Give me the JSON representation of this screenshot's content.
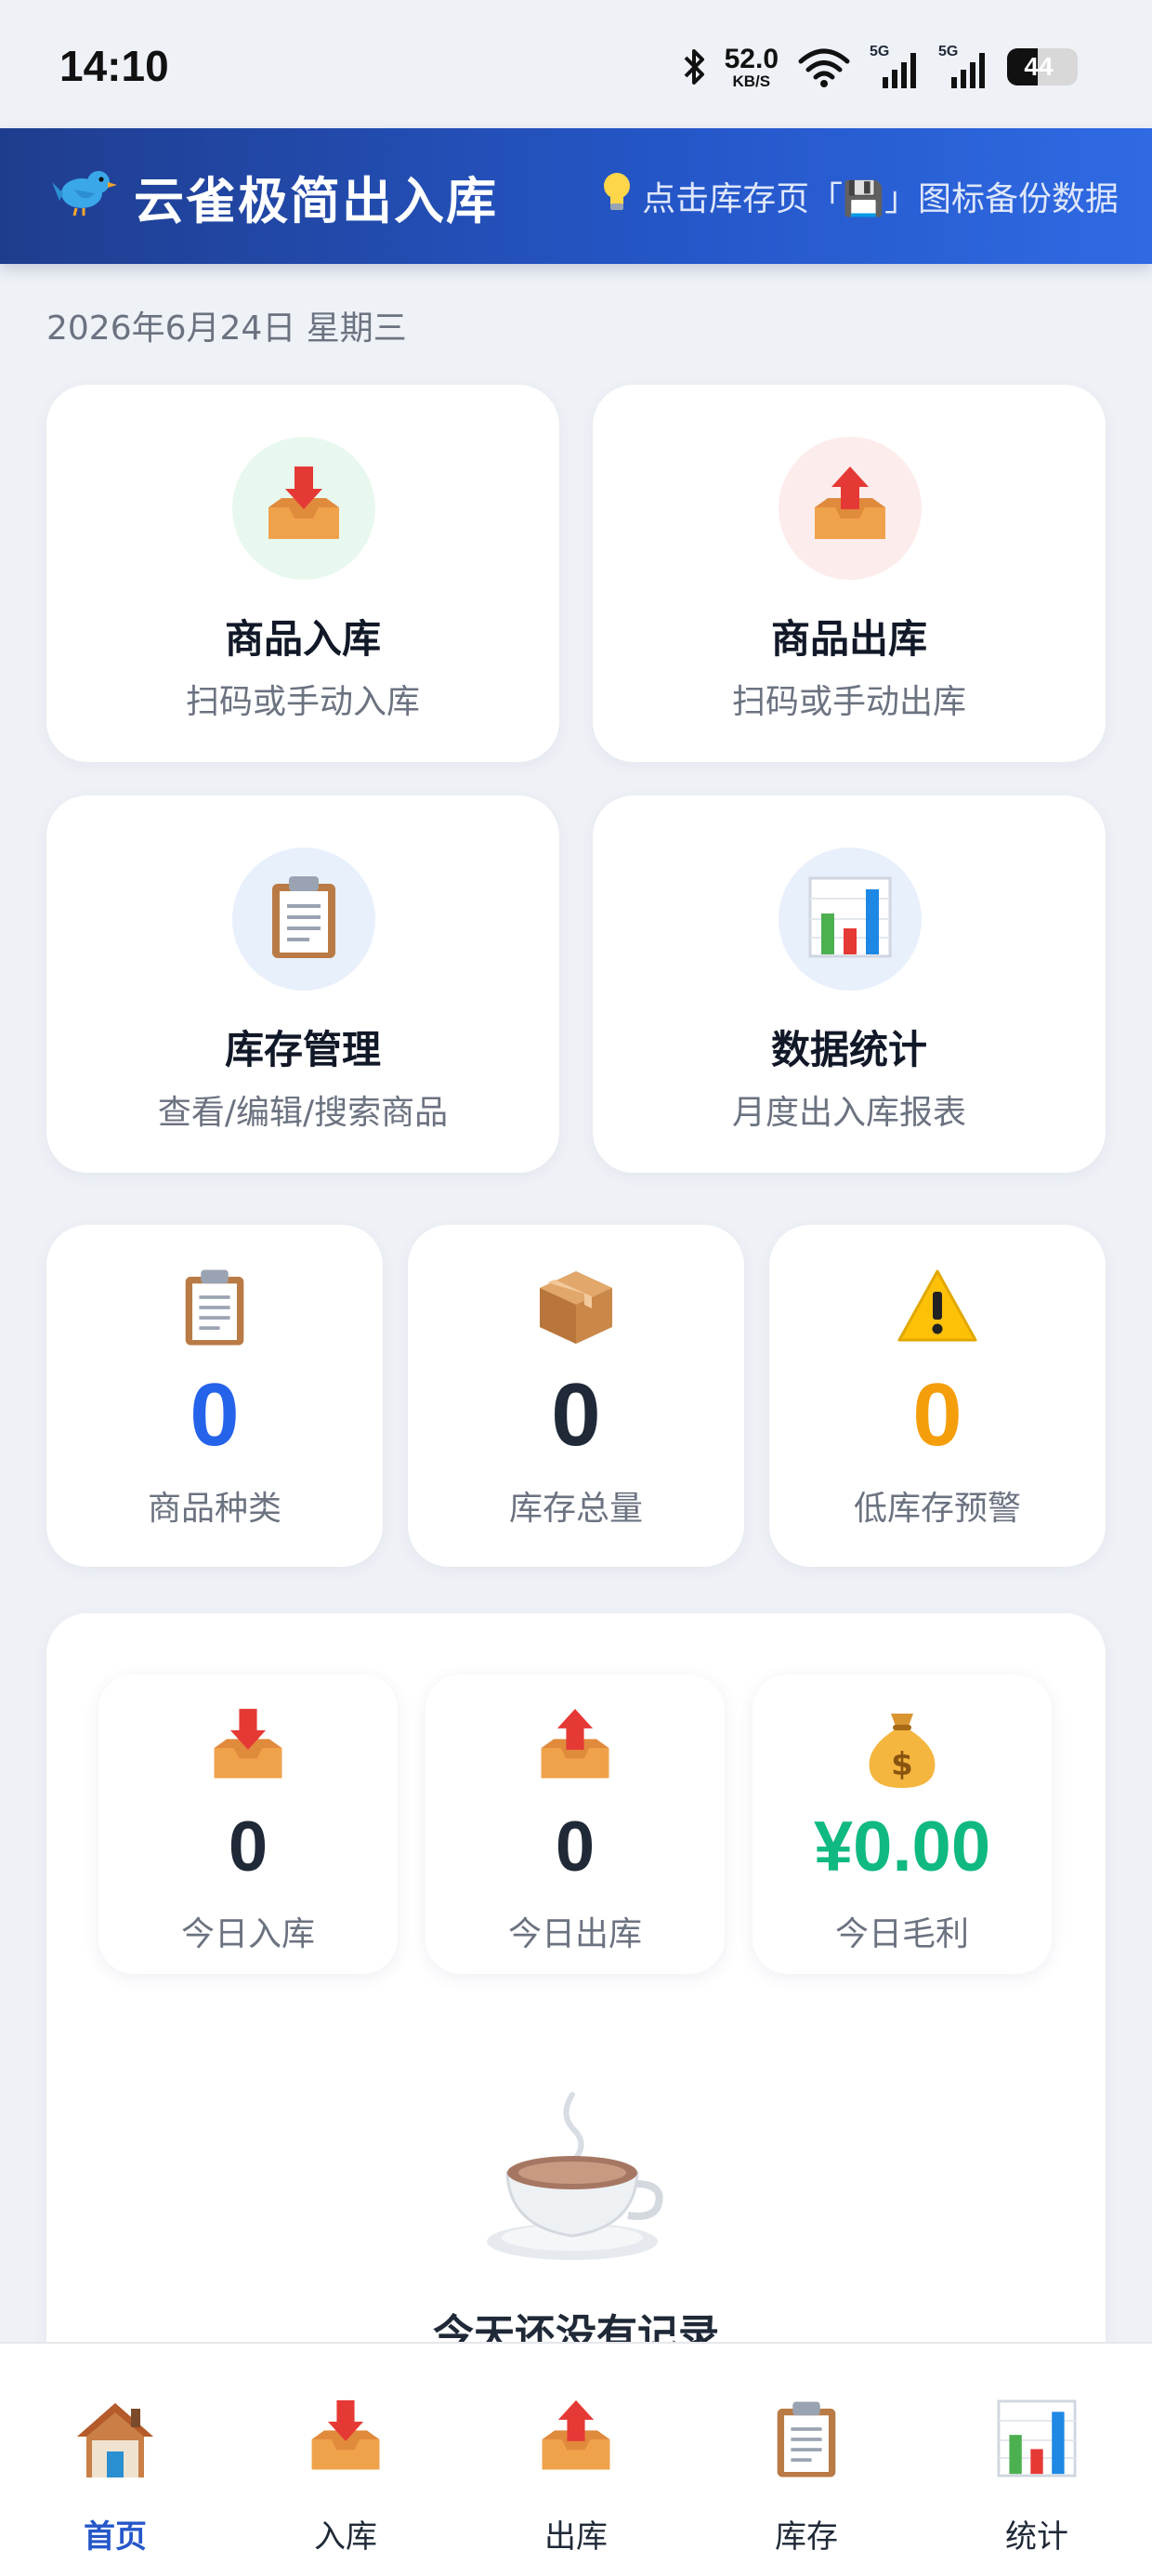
{
  "status_bar": {
    "time": "14:10",
    "net_speed_value": "52.0",
    "net_speed_unit": "KB/S",
    "signal_1_label": "5G",
    "signal_2_label": "5G",
    "battery_level": "44"
  },
  "header": {
    "title": "云雀极简出入库",
    "tip": "点击库存页「💾」图标备份数据"
  },
  "date": "2026年6月24日 星期三",
  "actions": [
    {
      "title": "商品入库",
      "subtitle": "扫码或手动入库",
      "icon": "inbox-in-icon",
      "circle_color": "#e8f8ef"
    },
    {
      "title": "商品出库",
      "subtitle": "扫码或手动出库",
      "icon": "inbox-out-icon",
      "circle_color": "#fdecec"
    },
    {
      "title": "库存管理",
      "subtitle": "查看/编辑/搜索商品",
      "icon": "clipboard-icon",
      "circle_color": "#e8f0fc"
    },
    {
      "title": "数据统计",
      "subtitle": "月度出入库报表",
      "icon": "bar-chart-icon",
      "circle_color": "#e8f0fc"
    }
  ],
  "stats": [
    {
      "value": "0",
      "label": "商品种类",
      "icon": "clipboard-icon",
      "color": "#2563eb"
    },
    {
      "value": "0",
      "label": "库存总量",
      "icon": "package-icon",
      "color": "#1f2937"
    },
    {
      "value": "0",
      "label": "低库存预警",
      "icon": "warning-icon",
      "color": "#f59e0b"
    }
  ],
  "today": [
    {
      "value": "0",
      "label": "今日入库",
      "icon": "inbox-in-icon",
      "color": "#1f2937"
    },
    {
      "value": "0",
      "label": "今日出库",
      "icon": "inbox-out-icon",
      "color": "#1f2937"
    },
    {
      "value": "¥0.00",
      "label": "今日毛利",
      "icon": "money-bag-icon",
      "color": "#10b981"
    }
  ],
  "empty_state": {
    "text": "今天还没有记录",
    "icon": "coffee-icon"
  },
  "nav": [
    {
      "label": "首页",
      "icon": "house-icon",
      "active": true
    },
    {
      "label": "入库",
      "icon": "inbox-in-icon",
      "active": false
    },
    {
      "label": "出库",
      "icon": "inbox-out-icon",
      "active": false
    },
    {
      "label": "库存",
      "icon": "clipboard-icon",
      "active": false
    },
    {
      "label": "统计",
      "icon": "bar-chart-icon",
      "active": false
    }
  ]
}
